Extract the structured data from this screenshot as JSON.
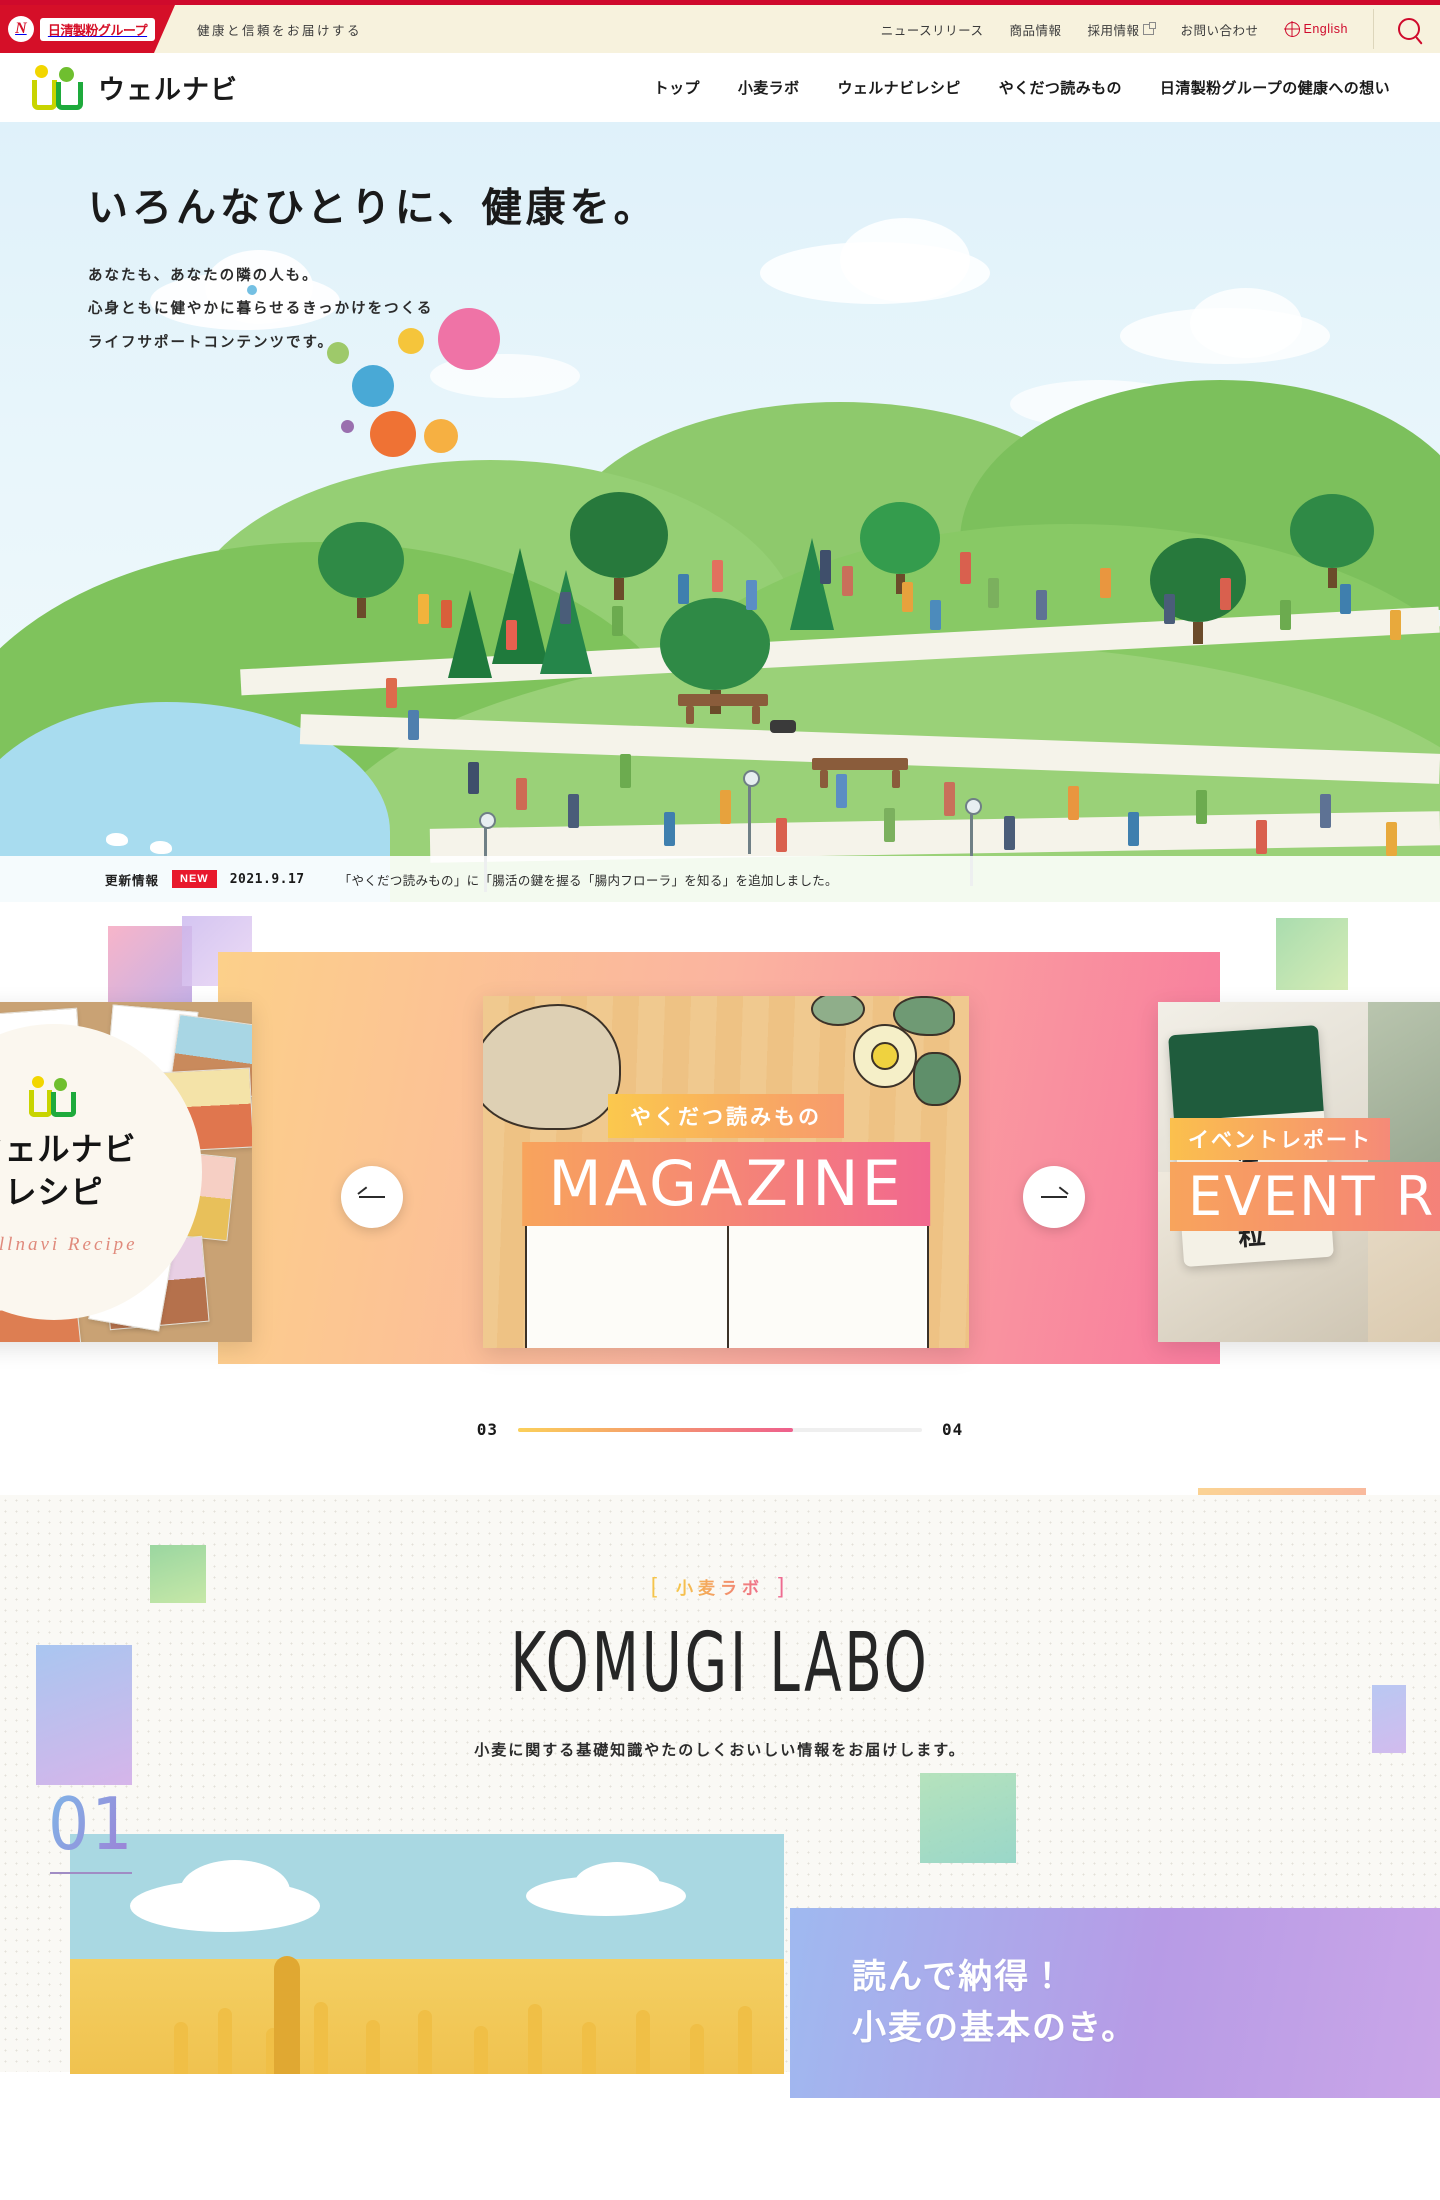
{
  "brand": {
    "group_logo_mark": "N",
    "group_logo_text": "日清製粉グループ",
    "tagline": "健康と信頼をお届けする",
    "site_name": "ウェルナビ",
    "logo_icon": "wellnavi-book-people-icon"
  },
  "utility_nav": {
    "items": [
      {
        "label": "ニュースリリース",
        "external": false
      },
      {
        "label": "商品情報",
        "external": false
      },
      {
        "label": "採用情報",
        "external": true
      },
      {
        "label": "お問い合わせ",
        "external": false
      },
      {
        "label": "English",
        "external": false,
        "icon": "globe-icon"
      }
    ],
    "search_icon": "search-icon"
  },
  "main_nav": {
    "items": [
      {
        "label": "トップ"
      },
      {
        "label": "小麦ラボ"
      },
      {
        "label": "ウェルナビレシピ"
      },
      {
        "label": "やくだつ読みもの"
      },
      {
        "label": "日清製粉グループの健康への想い"
      }
    ]
  },
  "hero": {
    "title": "いろんなひとりに、健康を。",
    "lines": [
      "あなたも、あなたの隣の人も。",
      "心身ともに健やかに暮らせるきっかけをつくる",
      "ライフサポートコンテンツです。"
    ]
  },
  "news": {
    "label": "更新情報",
    "badge": "NEW",
    "date": "2021.9.17",
    "text": "「やくだつ読みもの」に「腸活の鍵を握る「腸内フローラ」を知る」を追加しました。"
  },
  "carousel": {
    "prev_label": "前へ",
    "next_label": "次へ",
    "current": "03",
    "total": "04",
    "progress_percent": 68,
    "slides": [
      {
        "id": "wellnavi-recipe",
        "title_jp": "ウェルナビ\nレシピ",
        "title_line1": "ウェルナビ",
        "title_line2": "レシピ",
        "script": "Wellnavi Recipe"
      },
      {
        "id": "magazine",
        "tag_jp": "やくだつ読みもの",
        "tag_en": "MAGAZINE"
      },
      {
        "id": "event-report",
        "tag_jp": "イベントレポート",
        "tag_en": "EVENT REPORT",
        "bag_text": "日清 全粒粉"
      }
    ]
  },
  "komugi_labo": {
    "eyebrow_bracket_left": "[",
    "eyebrow": "小麦ラボ",
    "eyebrow_bracket_right": "]",
    "title": "KOMUGI LABO",
    "lead": "小麦に関する基礎知識やたのしくおいしい情報をお届けします。",
    "items": [
      {
        "number": "01",
        "heading_line1": "読んで納得！",
        "heading_line2": "小麦の基本のき。",
        "photo_alt": "wheat-field-photo"
      }
    ]
  },
  "colors": {
    "brand_red": "#cf0a2c",
    "group_red": "#d50f28",
    "utility_bg": "#f7f2dd",
    "accent_yellow": "#f6c84c",
    "accent_pink": "#ee6b90",
    "accent_green": "#1eaa3c",
    "accent_lime": "#c8d400",
    "hero_sky": "#dff1fa",
    "labo_bg": "#faf9f5",
    "panel_gradient_start": "#9fb9f0",
    "panel_gradient_end": "#caa6e8"
  }
}
